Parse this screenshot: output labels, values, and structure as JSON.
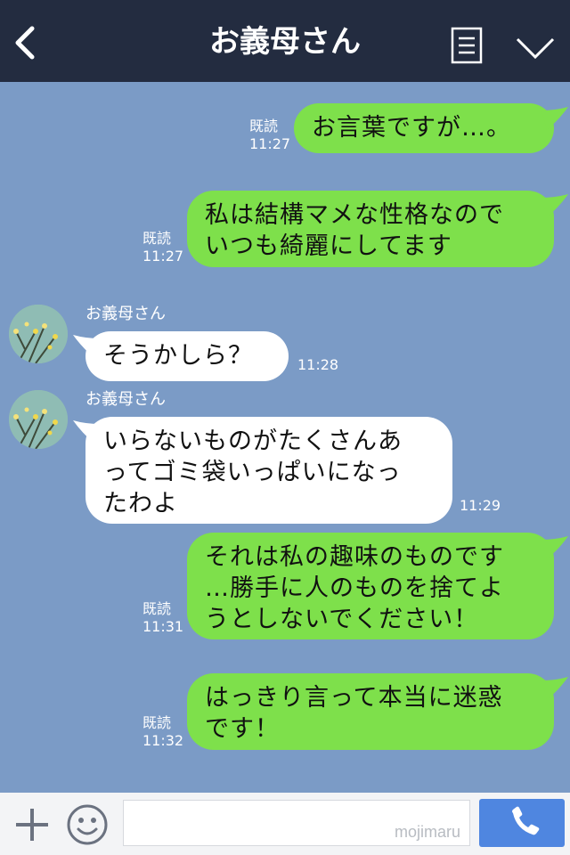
{
  "header": {
    "title": "お義母さん",
    "back_icon": "chevron-left-icon",
    "menu_icon": "list-icon",
    "expand_icon": "chevron-down-icon"
  },
  "messages": [
    {
      "side": "me",
      "lines": [
        "お言葉ですが…。"
      ],
      "read": "既読",
      "time": "11:27"
    },
    {
      "side": "me",
      "lines": [
        "私は結構マメな性格なので",
        "いつも綺麗にしてます"
      ],
      "read": "既読",
      "time": "11:27"
    },
    {
      "side": "them",
      "sender": "お義母さん",
      "lines": [
        "そうかしら？"
      ],
      "time": "11:28"
    },
    {
      "side": "them",
      "sender": "お義母さん",
      "lines": [
        "いらないものがたくさんあ",
        "ってゴミ袋いっぱいになっ",
        "たわよ"
      ],
      "time": "11:29"
    },
    {
      "side": "me",
      "lines": [
        "それは私の趣味のものです",
        "…勝手に人のものを捨てよ",
        "うとしないでください！"
      ],
      "read": "既読",
      "time": "11:31"
    },
    {
      "side": "me",
      "lines": [
        "はっきり言って本当に迷惑",
        "です！"
      ],
      "read": "既読",
      "time": "11:32"
    }
  ],
  "footer": {
    "input_value": "",
    "watermark": "mojimaru",
    "plus_icon": "plus-icon",
    "emoji_icon": "smiley-icon",
    "call_icon": "phone-icon"
  },
  "colors": {
    "header_bg": "#232c40",
    "chat_bg": "#7b9bc6",
    "my_bubble": "#7ee04b",
    "their_bubble": "#ffffff",
    "call_button": "#4f86e0"
  }
}
